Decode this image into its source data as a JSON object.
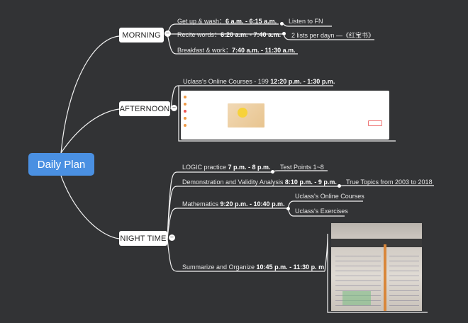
{
  "root": {
    "label": "Daily Plan"
  },
  "morning": {
    "label": "MORNING",
    "items": [
      {
        "text": "Get up & wash：",
        "time": "6 a.m. - 6:15 a.m.",
        "note": "Listen to FN"
      },
      {
        "text": "Recite words：",
        "time": "6:20 a.m. - 7:40 a.m.",
        "note": "2 lists per dayn —《红宝书》"
      },
      {
        "text": "Breakfast & work：",
        "time": "7:40 a.m. - 11:30 a.m."
      }
    ]
  },
  "afternoon": {
    "label": "AFTERNOON",
    "item": {
      "text": "Uclass's Online Courses - 199 ",
      "time": "12:20 p.m. - 1:30 p.m."
    }
  },
  "night": {
    "label": "NIGHT TIME",
    "items": [
      {
        "text": "LOGIC practice ",
        "time": "7 p.m. - 8 p.m.",
        "note": "Test Points 1~8"
      },
      {
        "text": "Demonstration and Validity Analysis ",
        "time": "8:10 p.m. - 9 p.m.",
        "note": "True Topics from 2003 to 2018"
      },
      {
        "text": "Mathematics ",
        "time": "9:20 p.m. - 10:40 p.m.",
        "notes": [
          "Uclass's Online Courses",
          "Uclass's Exercises"
        ]
      },
      {
        "text": "Summarize and Organize ",
        "time": "10:45 p.m. - 11:30 p. m"
      }
    ]
  }
}
